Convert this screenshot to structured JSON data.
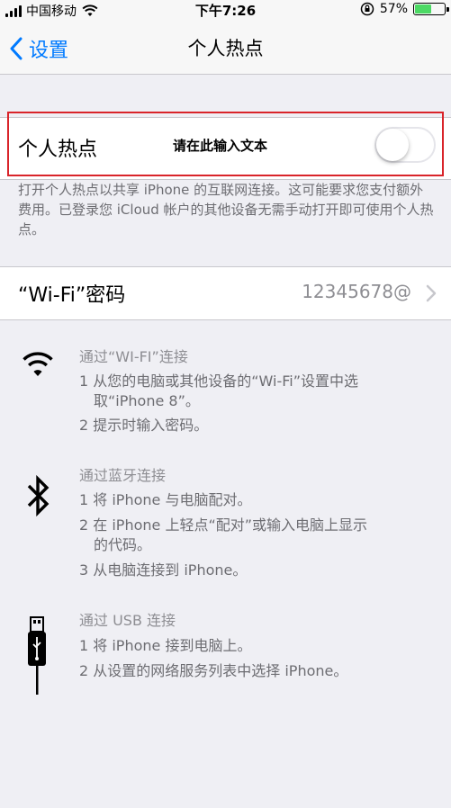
{
  "status_bar": {
    "carrier": "中国移动",
    "time": "下午7:26",
    "battery_percent": "57%",
    "battery_level": 0.57
  },
  "nav": {
    "back_label": "设置",
    "title": "个人热点"
  },
  "hotspot": {
    "label": "个人热点",
    "overlay_text": "请在此输入文本",
    "enabled": false
  },
  "description": "打开个人热点以共享 iPhone 的互联网连接。这可能要求您支付额外费用。已登录您 iCloud 帐户的其他设备无需手动打开即可使用个人热点。",
  "wifi_password": {
    "label": "“Wi-Fi”密码",
    "value": "12345678@"
  },
  "instructions": {
    "wifi": {
      "title": "通过“WI-FI”连接",
      "step1a": "1 从您的电脑或其他设备的“Wi-Fi”设置中选",
      "step1b": "取“iPhone 8”。",
      "step2": "2 提示时输入密码。"
    },
    "bluetooth": {
      "title": "通过蓝牙连接",
      "step1": "1 将 iPhone 与电脑配对。",
      "step2a": "2 在 iPhone 上轻点“配对”或输入电脑上显示",
      "step2b": "的代码。",
      "step3": "3 从电脑连接到 iPhone。"
    },
    "usb": {
      "title": "通过 USB 连接",
      "step1": "1 将 iPhone 接到电脑上。",
      "step2": "2 从设置的网络服务列表中选择 iPhone。"
    }
  },
  "colors": {
    "accent": "#007aff",
    "highlight_box": "#d9242a",
    "battery_fill": "#4cd964"
  }
}
